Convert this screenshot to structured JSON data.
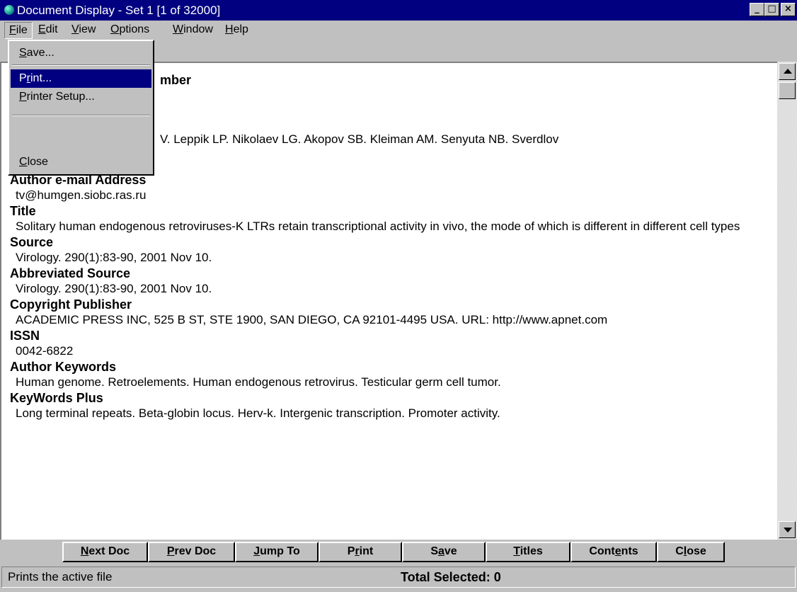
{
  "window": {
    "title": "Document Display - Set 1 [1 of 32000]",
    "controls": {
      "minimize": "_",
      "restore": "□",
      "close": "×"
    }
  },
  "menubar": {
    "file": {
      "pre": "",
      "u": "F",
      "post": "ile"
    },
    "edit": {
      "pre": "",
      "u": "E",
      "post": "dit"
    },
    "view": {
      "pre": "",
      "u": "V",
      "post": "iew"
    },
    "options": {
      "pre": "",
      "u": "O",
      "post": "ptions"
    },
    "window": {
      "pre": "",
      "u": "W",
      "post": "indow"
    },
    "help": {
      "pre": "",
      "u": "H",
      "post": "elp"
    }
  },
  "file_menu": {
    "save": {
      "pre": "",
      "u": "S",
      "post": "ave..."
    },
    "print": {
      "pre": "P",
      "u": "r",
      "post": "int..."
    },
    "printer_setup": {
      "pre": "",
      "u": "P",
      "post": "rinter Setup..."
    },
    "close": {
      "pre": "",
      "u": "C",
      "post": "lose"
    }
  },
  "document": {
    "partial_heading": "mber",
    "partial_authors": "V. Leppik LP. Nikolaev LG. Akopov SB. Kleiman AM. Senyuta NB. Sverdlov",
    "fields": [
      {
        "label": "Author e-mail Address",
        "value": "tv@humgen.siobc.ras.ru"
      },
      {
        "label": "Title",
        "value": "Solitary human endogenous retroviruses-K LTRs retain transcriptional activity in vivo, the mode of which is different in different cell types"
      },
      {
        "label": "Source",
        "value": "Virology. 290(1):83-90, 2001 Nov 10."
      },
      {
        "label": "Abbreviated Source",
        "value": "Virology. 290(1):83-90, 2001 Nov 10."
      },
      {
        "label": "Copyright Publisher",
        "value": "ACADEMIC PRESS INC, 525 B ST, STE 1900, SAN DIEGO, CA 92101-4495 USA. URL: http://www.apnet.com"
      },
      {
        "label": "ISSN",
        "value": "0042-6822"
      },
      {
        "label": "Author Keywords",
        "value": "Human genome.  Retroelements.  Human endogenous retrovirus.  Testicular germ cell tumor."
      },
      {
        "label": "KeyWords Plus",
        "value": "Long terminal repeats.  Beta-globin locus.  Herv-k.  Intergenic transcription.  Promoter activity."
      }
    ]
  },
  "buttons": {
    "next_doc": {
      "pre": "",
      "u": "N",
      "post": "ext Doc"
    },
    "prev_doc": {
      "pre": "",
      "u": "P",
      "post": "rev Doc"
    },
    "jump_to": {
      "pre": "",
      "u": "J",
      "post": "ump To"
    },
    "print": {
      "pre": "P",
      "u": "r",
      "post": "int"
    },
    "save": {
      "pre": "S",
      "u": "a",
      "post": "ve"
    },
    "titles": {
      "pre": "",
      "u": "T",
      "post": "itles"
    },
    "contents": {
      "pre": "Cont",
      "u": "e",
      "post": "nts"
    },
    "close": {
      "pre": "C",
      "u": "l",
      "post": "ose"
    }
  },
  "status": {
    "message": "Prints the active file",
    "total_selected": "Total Selected: 0"
  }
}
